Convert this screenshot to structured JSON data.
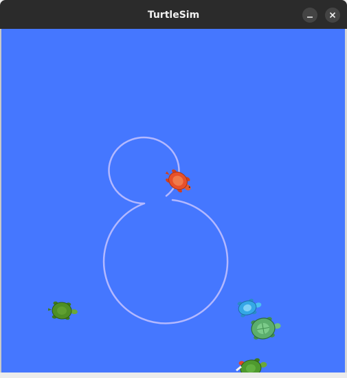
{
  "window": {
    "title": "TurtleSim",
    "minimize_icon": "minimize-icon",
    "close_icon": "close-icon"
  },
  "canvas": {
    "background_color": "#4577ff",
    "pen_color": "#b3b8ff"
  },
  "turtles": [
    {
      "name": "turtle-red",
      "color": "#e8502a"
    },
    {
      "name": "turtle-olive",
      "color": "#4e8f25"
    },
    {
      "name": "turtle-blue",
      "color": "#35a7e6"
    },
    {
      "name": "turtle-green",
      "color": "#5cae6d"
    },
    {
      "name": "turtle-bottom",
      "color": "#4e9a2e"
    }
  ]
}
